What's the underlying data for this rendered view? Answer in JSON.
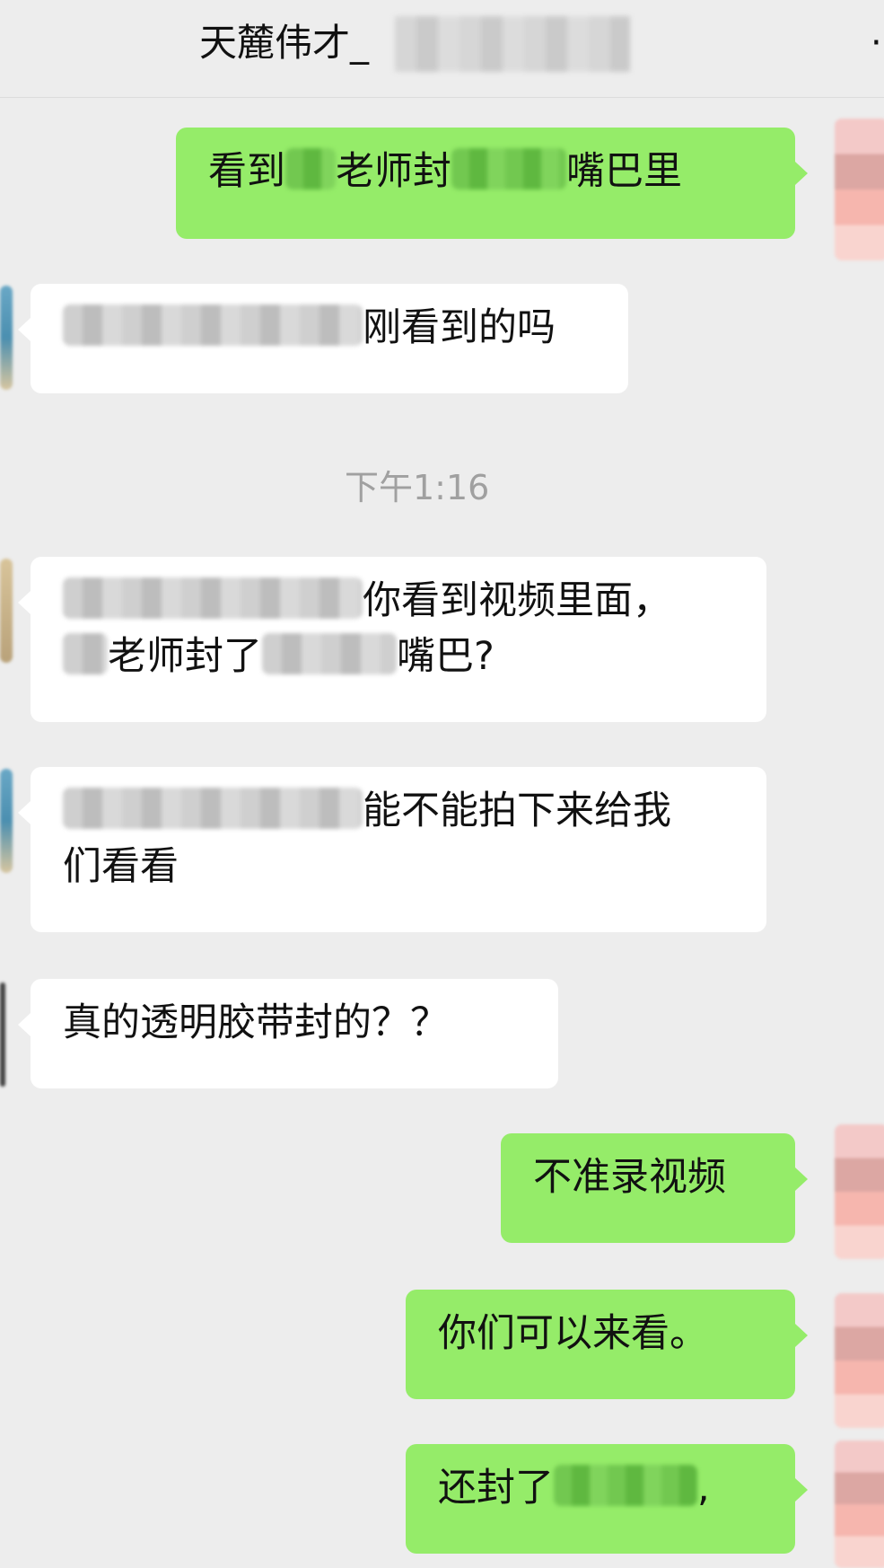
{
  "header": {
    "title": "天麓伟才_",
    "more": "·"
  },
  "timestamp": "下午1:16",
  "messages": [
    {
      "dir": "out",
      "segments": [
        "看到",
        "老师封",
        "嘴巴里"
      ]
    },
    {
      "dir": "in",
      "segments": [
        "刚看到的吗"
      ]
    },
    {
      "dir": "in",
      "segments": [
        "你看到视频里面，",
        "老师封了",
        "嘴巴?"
      ]
    },
    {
      "dir": "in",
      "segments": [
        "能不能拍下来给我",
        "们看看"
      ]
    },
    {
      "dir": "in",
      "segments": [
        "真的透明胶带封的？？"
      ]
    },
    {
      "dir": "out",
      "segments": [
        "不准录视频"
      ]
    },
    {
      "dir": "out",
      "segments": [
        "你们可以来看。"
      ]
    },
    {
      "dir": "out",
      "segments": [
        "还封了",
        ","
      ]
    }
  ]
}
